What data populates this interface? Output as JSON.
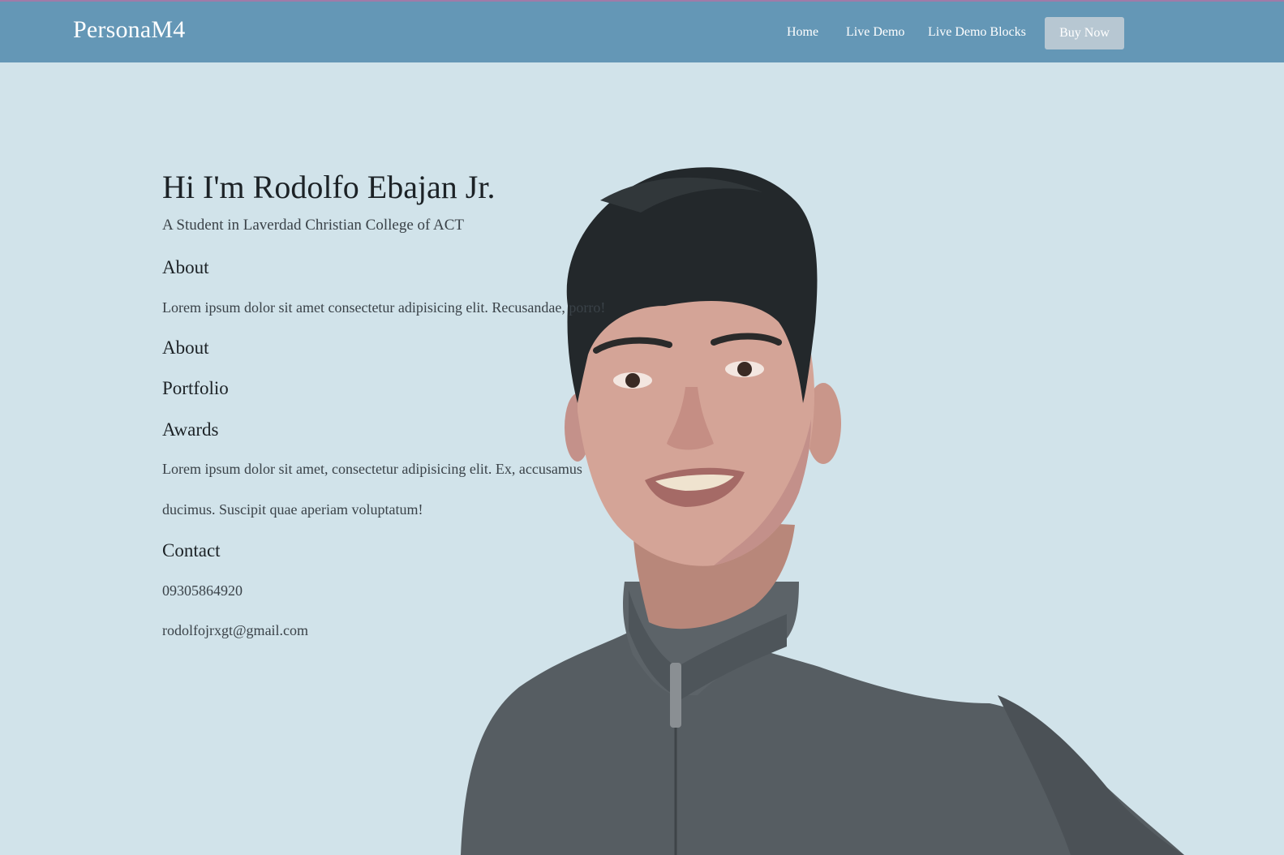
{
  "nav": {
    "brand": "PersonaM4",
    "links": [
      "Home",
      "Live Demo",
      "Live Demo Blocks"
    ],
    "cta": "Buy Now"
  },
  "hero": {
    "title": "Hi I'm Rodolfo Ebajan Jr.",
    "subtitle": "A Student in Laverdad Christian College of ACT"
  },
  "about": {
    "heading": "About",
    "text": "Lorem ipsum dolor sit amet consectetur adipisicing elit. Recusandae, porro!"
  },
  "about2": {
    "heading": "About"
  },
  "portfolio": {
    "heading": "Portfolio"
  },
  "awards": {
    "heading": "Awards",
    "text_line1": "Lorem ipsum dolor sit amet, consectetur adipisicing elit. Ex, accusamus",
    "text_line2": "ducimus. Suscipit quae aperiam voluptatum!"
  },
  "contact": {
    "heading": "Contact",
    "phone": "09305864920",
    "email": "rodolfojrxgt@gmail.com"
  },
  "colors": {
    "navbar": "#6497b6",
    "background": "#d1e3ea",
    "button": "#b7c7d2",
    "top_border": "#a07ba8"
  }
}
